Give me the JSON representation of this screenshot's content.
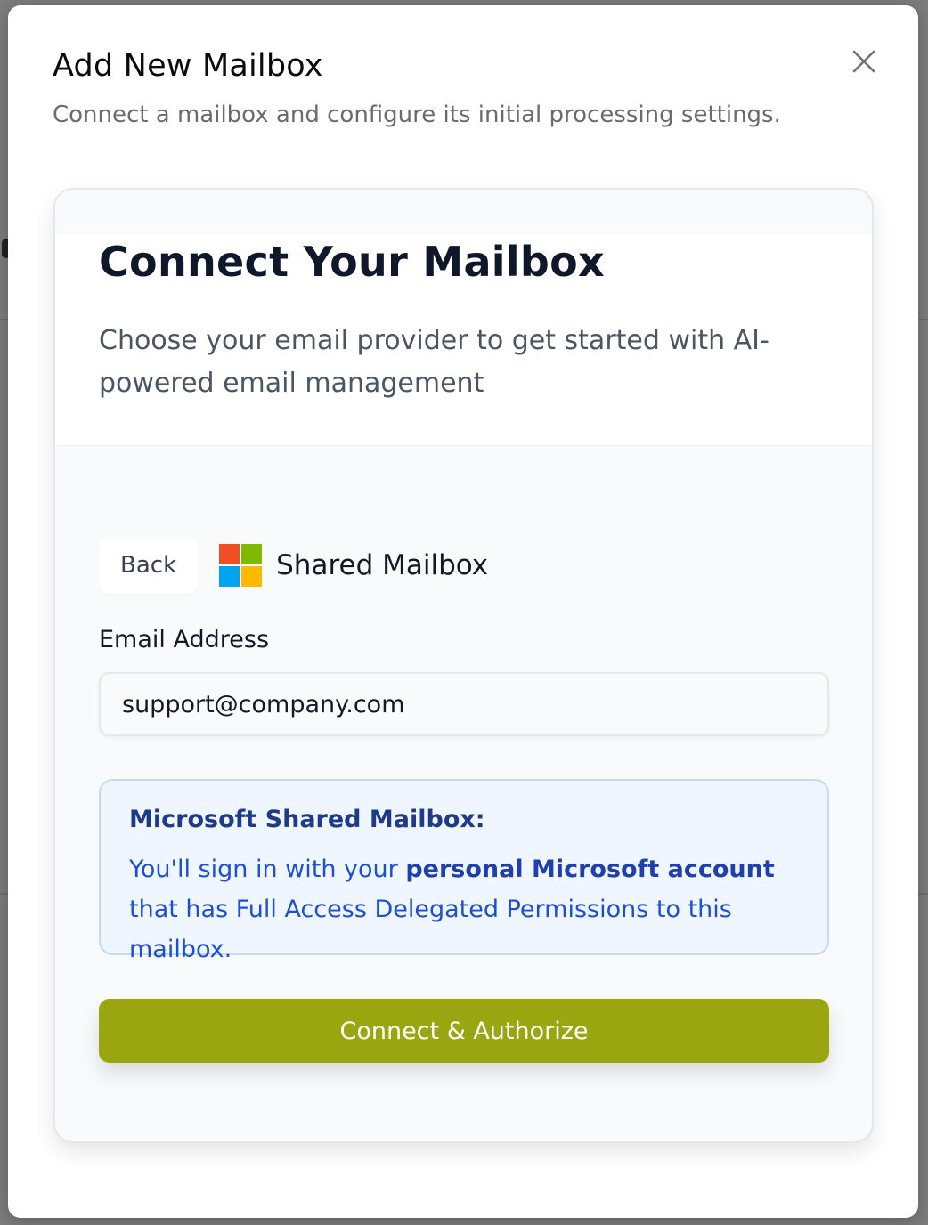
{
  "modal": {
    "title": "Add New Mailbox",
    "subtitle": "Connect a mailbox and configure its initial processing settings.",
    "close_icon": "close-icon"
  },
  "card": {
    "title": "Connect Your Mailbox",
    "description": "Choose your email provider to get started with AI-powered email management"
  },
  "provider": {
    "back_label": "Back",
    "name": "Shared Mailbox",
    "logo_icon": "microsoft-logo-icon",
    "logo_colors": [
      "#f25022",
      "#7fba00",
      "#00a4ef",
      "#ffb900"
    ]
  },
  "form": {
    "email_label": "Email Address",
    "email_value": "support@company.com"
  },
  "info": {
    "title": "Microsoft Shared Mailbox:",
    "text_before": "You'll sign in with your ",
    "text_bold": "personal Microsoft account",
    "text_after": " that has Full Access Delegated Permissions to this mailbox."
  },
  "actions": {
    "connect_label": "Connect & Authorize",
    "connect_color": "#99a610"
  }
}
